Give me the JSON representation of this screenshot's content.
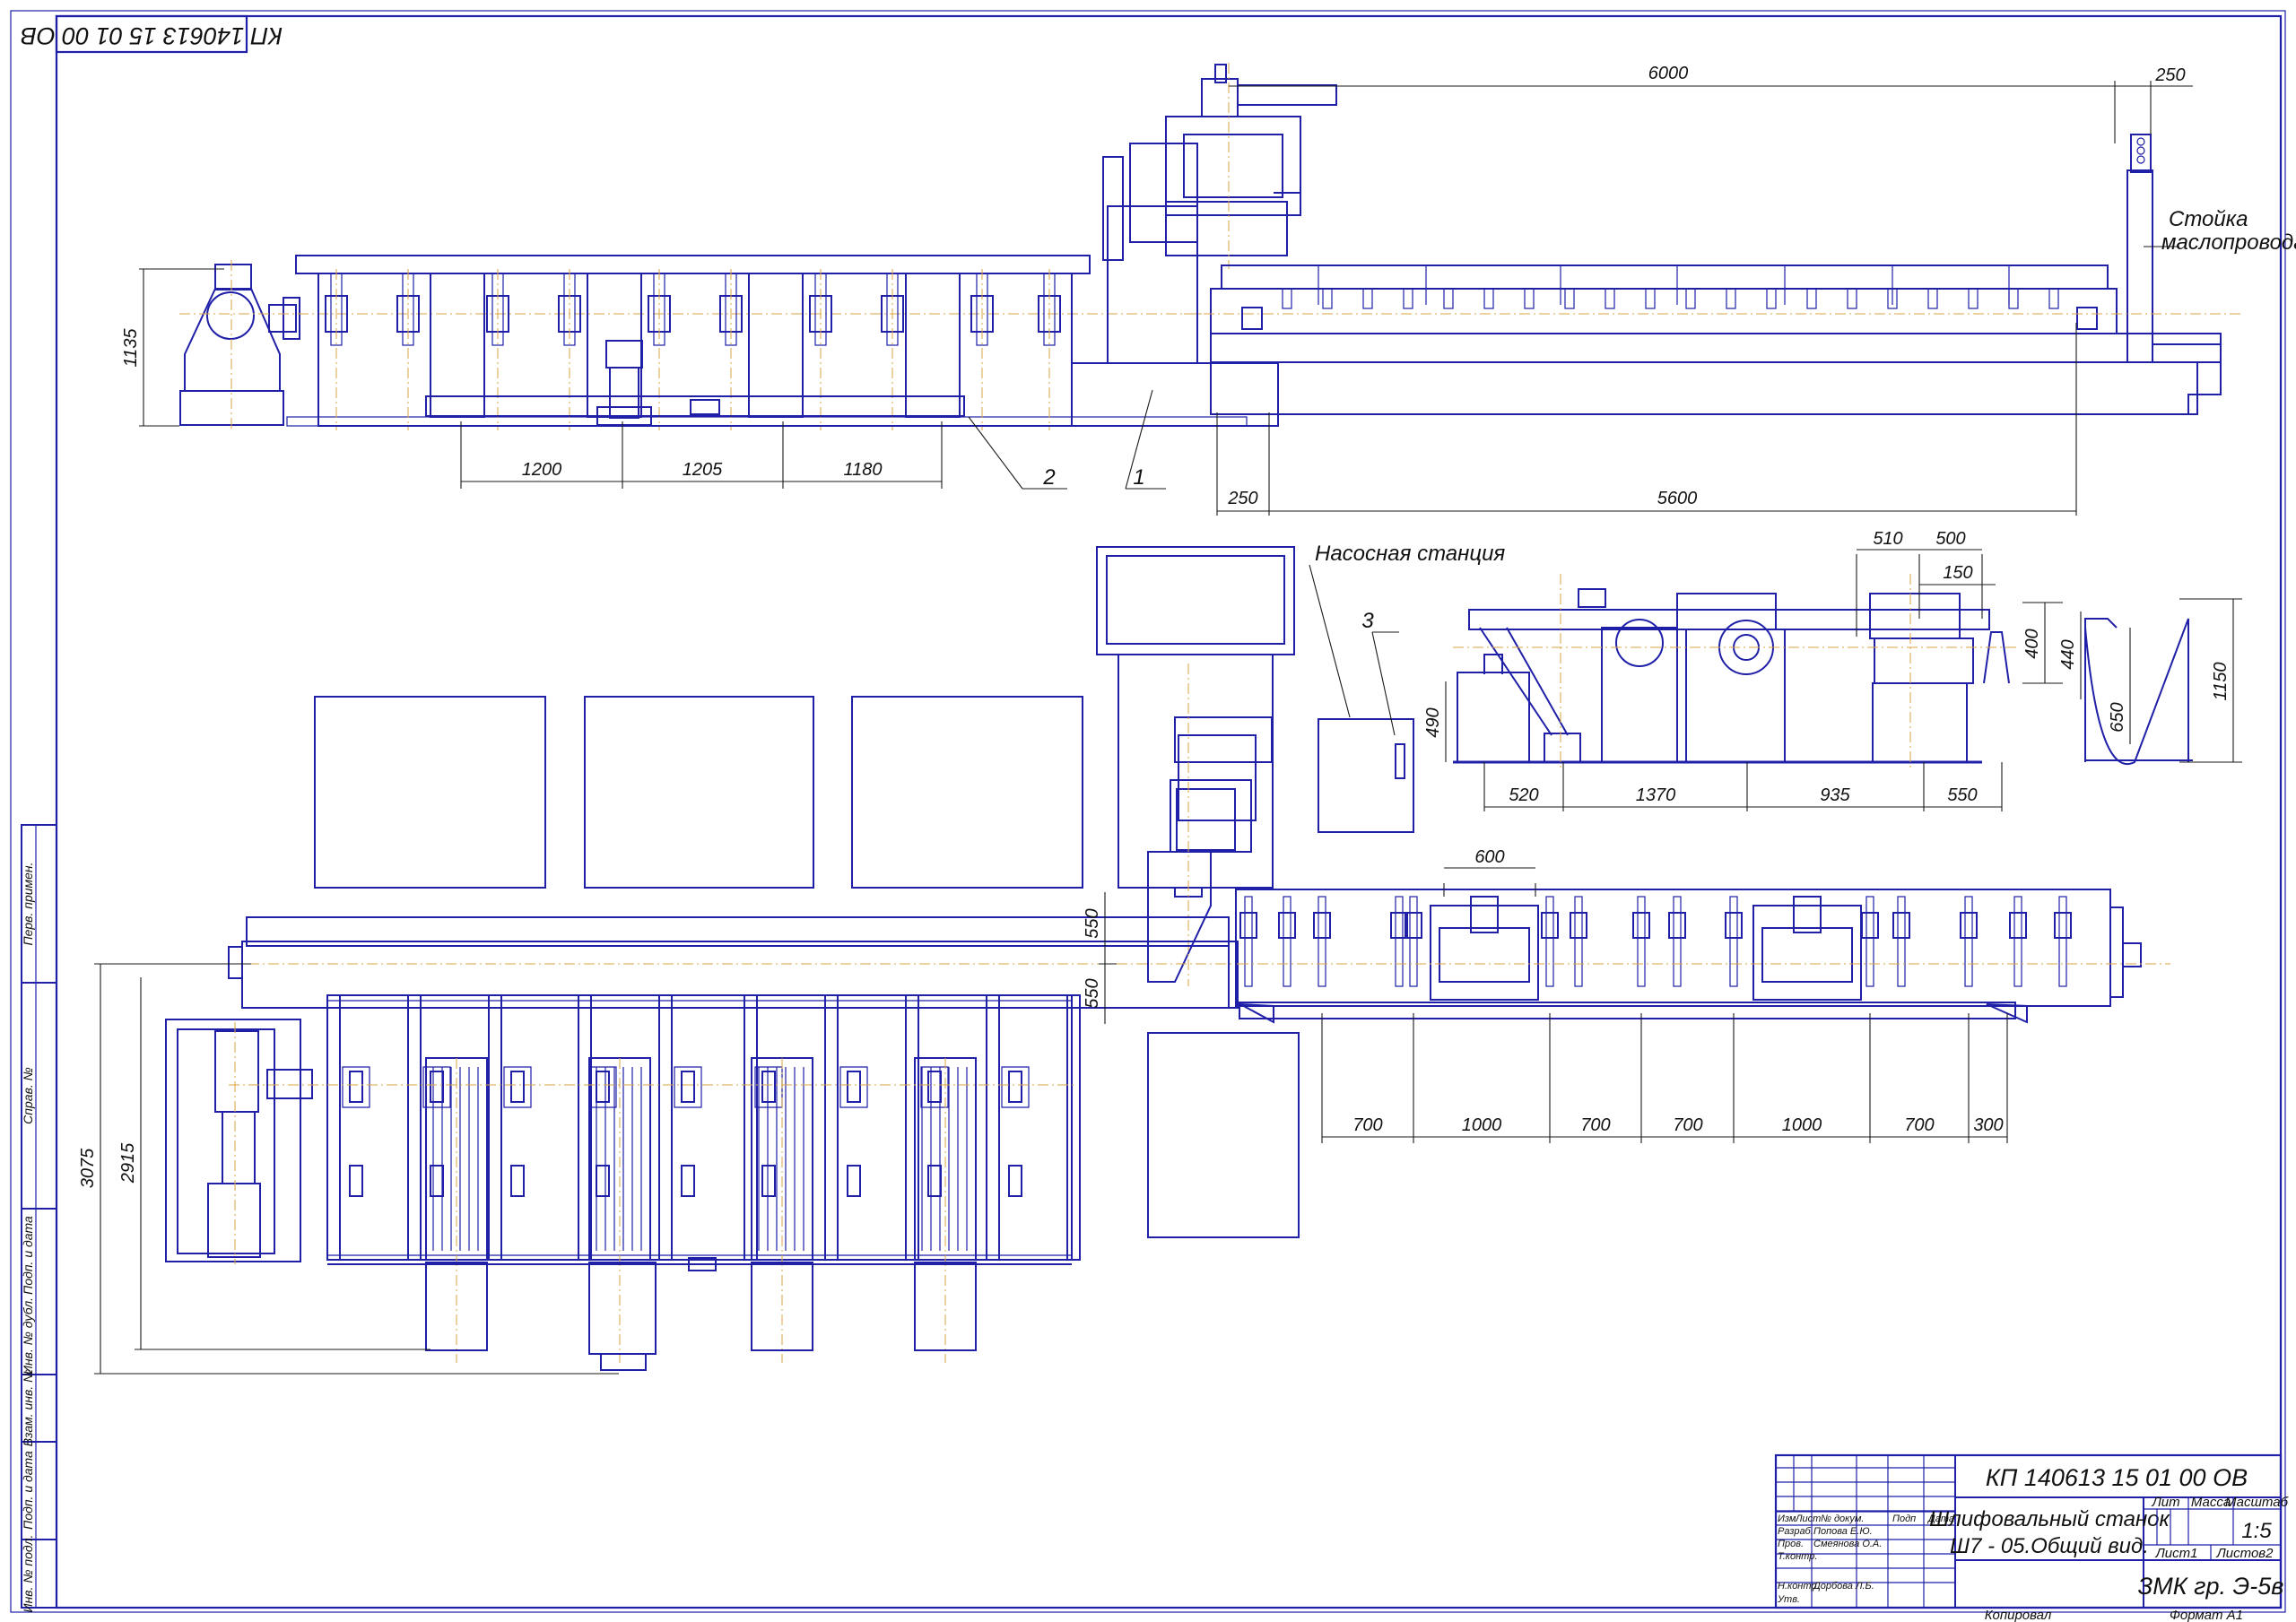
{
  "stamp_code_rotated": "КП 140613 15 01 00 ОВ",
  "labels": {
    "stand": "Стойка",
    "stand2": "маслопровода",
    "pump": "Насосная станция",
    "n1": "1",
    "n2": "2",
    "n3": "3"
  },
  "dims_top": {
    "d6000": "6000",
    "d250a": "250",
    "d1135": "1135",
    "d1200": "1200",
    "d1205": "1205",
    "d1180": "1180",
    "d250b": "250",
    "d5600": "5600"
  },
  "dims_side": {
    "d510": "510",
    "d500": "500",
    "d150": "150",
    "d400": "400",
    "d440": "440",
    "d1150": "1150",
    "d490": "490",
    "d650": "650",
    "d520": "520",
    "d1370": "1370",
    "d935": "935",
    "d550": "550"
  },
  "dims_plan": {
    "d600": "600",
    "d550a": "550",
    "d550b": "550",
    "d3075": "3075",
    "d2915": "2915",
    "d700a": "700",
    "d1000a": "1000",
    "d700b": "700",
    "d700c": "700",
    "d1000b": "1000",
    "d700d": "700",
    "d300": "300"
  },
  "side_stamp": {
    "perv": "Перв. примен.",
    "sprav": "Справ. №",
    "podp1": "Подп. и дата",
    "invdubl": "Инв. № дубл.",
    "vzam": "Взам. инв. №",
    "podp2": "Подп. и дата",
    "invpodl": "Инв. № подл."
  },
  "title_block": {
    "code": "КП 140613 15 01 00 ОВ",
    "name_l1": "Шлифовальный станок",
    "name_l2": "Ш7 - 05.Общий вид.",
    "lit": "Лит",
    "massa": "Масса",
    "masshtab": "Масштаб",
    "scale": "1:5",
    "list": "Лист1",
    "listov": "Листов2",
    "org": "ЗМК гр. Э-5в",
    "izm": "Изм",
    "list_h": "Лист",
    "ndokum": "№ докум.",
    "podp": "Подп",
    "data": "Дата",
    "razrab": "Разраб.",
    "razrab_name": "Попова Е.Ю.",
    "prov": "Пров.",
    "prov_name": "Смеянова О.А.",
    "tkontr": "Т.контр.",
    "nkontr": "Н.контр.",
    "nkontr_name": "Дорбова Л.Б.",
    "utv": "Утв.",
    "kopiroval": "Копировал",
    "format": "Формат А1"
  }
}
